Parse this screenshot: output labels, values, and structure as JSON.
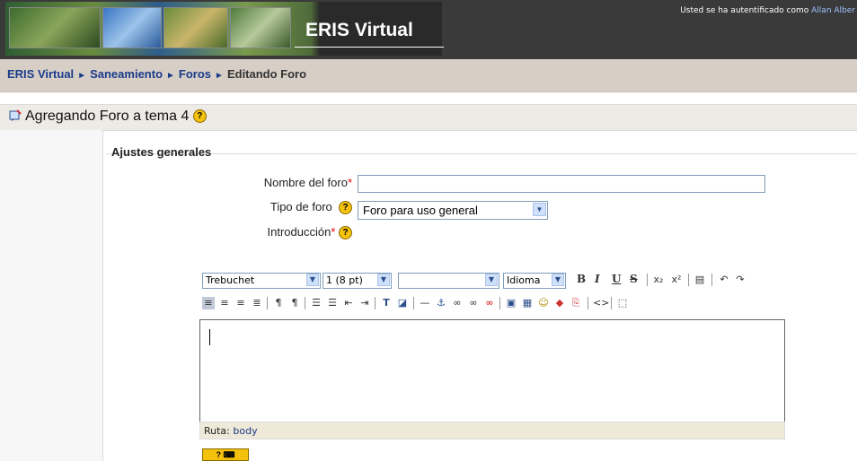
{
  "header": {
    "site_title": "ERIS Virtual",
    "login_text": "Usted se ha autentificado como",
    "user_name": "Allan Alber"
  },
  "breadcrumb": {
    "items": [
      "ERIS Virtual",
      "Saneamiento",
      "Foros",
      "Editando Foro"
    ]
  },
  "page": {
    "heading": "Agregando Foro a tema 4"
  },
  "form": {
    "legend": "Ajustes generales",
    "name_label": "Nombre del foro",
    "type_label": "Tipo de foro",
    "type_value": "Foro para uso general",
    "intro_label": "Introducción",
    "required_mark": "*"
  },
  "editor": {
    "font_family": "Trebuchet",
    "font_size": "1 (8 pt)",
    "heading_select": "",
    "language": "Idioma",
    "path_label": "Ruta:",
    "path_value": "body"
  },
  "icons": {
    "help": "?",
    "breadcrumb_sep": "►"
  }
}
